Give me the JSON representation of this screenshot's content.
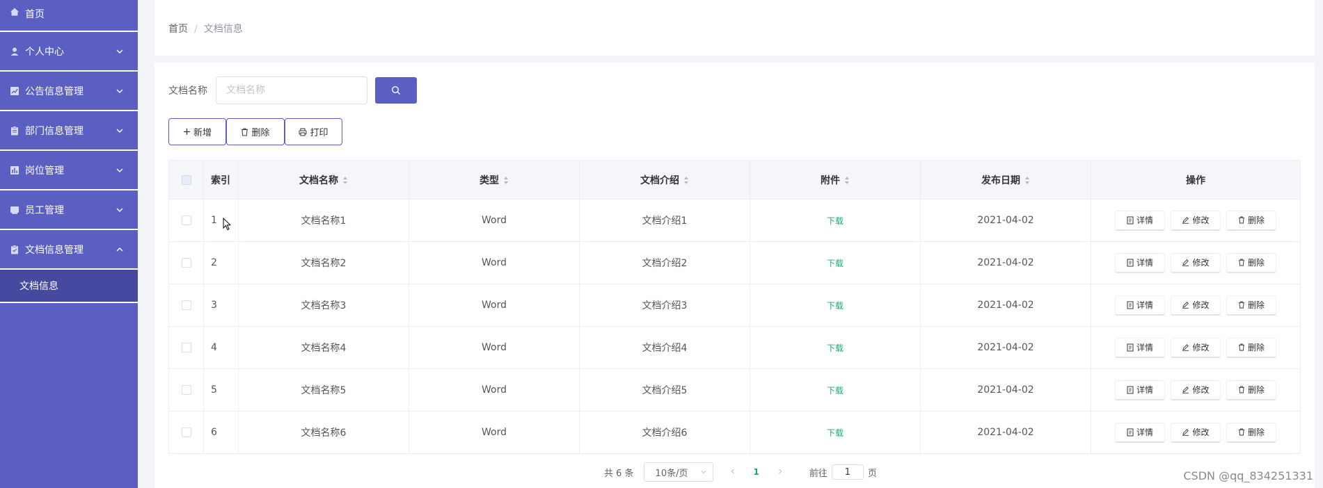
{
  "sidebar": {
    "items": [
      {
        "label": "首页",
        "icon": "home-icon",
        "expandable": false
      },
      {
        "label": "个人中心",
        "icon": "user-icon",
        "expandable": true,
        "expanded": false
      },
      {
        "label": "公告信息管理",
        "icon": "chart-icon",
        "expandable": true,
        "expanded": false
      },
      {
        "label": "部门信息管理",
        "icon": "clipboard-icon",
        "expandable": true,
        "expanded": false
      },
      {
        "label": "岗位管理",
        "icon": "bar-chart-icon",
        "expandable": true,
        "expanded": false
      },
      {
        "label": "员工管理",
        "icon": "folder-icon",
        "expandable": true,
        "expanded": false
      },
      {
        "label": "文档信息管理",
        "icon": "clipboard-check-icon",
        "expandable": true,
        "expanded": true
      }
    ],
    "active_sub": "文档信息"
  },
  "breadcrumb": {
    "home": "首页",
    "sep": "/",
    "current": "文档信息"
  },
  "search": {
    "label": "文档名称",
    "placeholder": "文档名称",
    "value": ""
  },
  "toolbar": {
    "add": "新增",
    "delete": "删除",
    "print": "打印"
  },
  "table": {
    "headers": {
      "index": "索引",
      "name": "文档名称",
      "type": "类型",
      "intro": "文档介绍",
      "attachment": "附件",
      "date": "发布日期",
      "ops": "操作"
    },
    "rows": [
      {
        "index": "1",
        "name": "文档名称1",
        "type": "Word",
        "intro": "文档介绍1",
        "attachment": "下载",
        "date": "2021-04-02"
      },
      {
        "index": "2",
        "name": "文档名称2",
        "type": "Word",
        "intro": "文档介绍2",
        "attachment": "下载",
        "date": "2021-04-02"
      },
      {
        "index": "3",
        "name": "文档名称3",
        "type": "Word",
        "intro": "文档介绍3",
        "attachment": "下载",
        "date": "2021-04-02"
      },
      {
        "index": "4",
        "name": "文档名称4",
        "type": "Word",
        "intro": "文档介绍4",
        "attachment": "下载",
        "date": "2021-04-02"
      },
      {
        "index": "5",
        "name": "文档名称5",
        "type": "Word",
        "intro": "文档介绍5",
        "attachment": "下载",
        "date": "2021-04-02"
      },
      {
        "index": "6",
        "name": "文档名称6",
        "type": "Word",
        "intro": "文档介绍6",
        "attachment": "下载",
        "date": "2021-04-02"
      }
    ],
    "row_ops": {
      "detail": "详情",
      "edit": "修改",
      "delete": "删除"
    }
  },
  "pagination": {
    "total": "共 6 条",
    "page_size": "10条/页",
    "current_page": "1",
    "goto_prefix": "前往",
    "goto_value": "1",
    "goto_suffix": "页"
  },
  "watermark": "CSDN @qq_834251331",
  "colors": {
    "sidebar": "#5b5fc1",
    "sidebar_active": "#46499f",
    "accent": "#5b5fc1",
    "download": "#1aa87a"
  }
}
